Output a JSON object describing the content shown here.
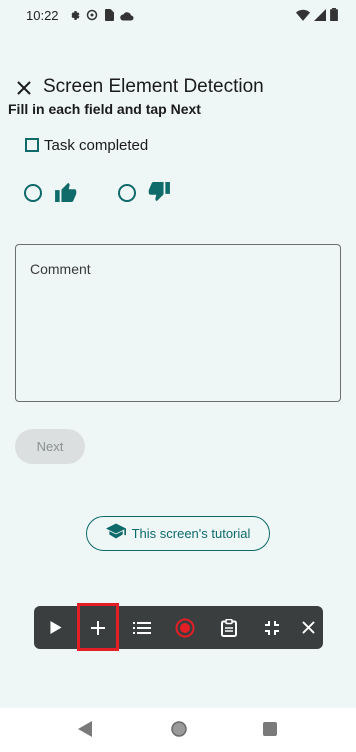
{
  "status_bar": {
    "time": "10:22",
    "left_icons": [
      "gear-icon",
      "at-icon",
      "sim-icon",
      "cloud-icon"
    ],
    "right_icons": [
      "wifi-icon",
      "signal-icon",
      "battery-icon"
    ]
  },
  "header": {
    "title": "Screen Element Detection",
    "subtitle": "Fill in each field and tap Next"
  },
  "form": {
    "checkbox_label": "Task completed",
    "checkbox_checked": false,
    "rating_options": [
      "thumbs-up",
      "thumbs-down"
    ],
    "comment_placeholder": "Comment",
    "next_label": "Next",
    "next_enabled": false
  },
  "tutorial": {
    "label": "This screen's tutorial"
  },
  "toolbar": {
    "items": [
      "play-icon",
      "plus-icon",
      "list-icon",
      "record-icon",
      "clipboard-icon",
      "collapse-icon",
      "close-icon"
    ],
    "highlighted_item": "plus-icon"
  },
  "colors": {
    "accent": "#0f6a6a",
    "background": "#eef6f6",
    "toolbar_bg": "#3a3e3f",
    "record": "#e31e24",
    "highlight": "#e31e24"
  }
}
